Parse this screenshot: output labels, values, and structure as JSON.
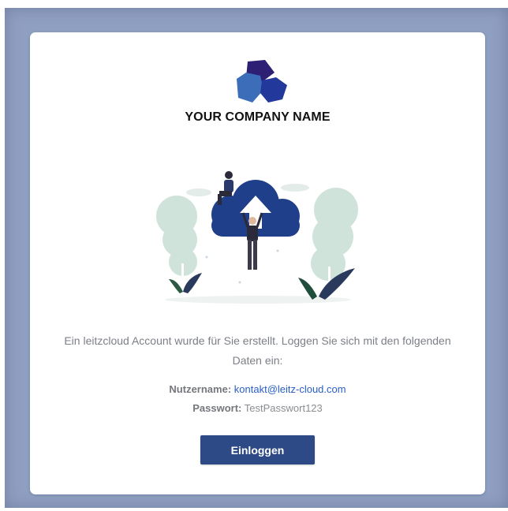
{
  "company": {
    "name": "YOUR COMPANY NAME"
  },
  "message": {
    "text": "Ein leitzcloud Account wurde für Sie erstellt. Loggen Sie sich mit den folgenden Daten ein:"
  },
  "credentials": {
    "username_label": "Nutzername:",
    "username_value": "kontakt@leitz-cloud.com",
    "password_label": "Passwort:",
    "password_value": "TestPasswort123"
  },
  "actions": {
    "login_label": "Einloggen"
  },
  "colors": {
    "backdrop": "#8f9fc1",
    "button": "#2d4a86",
    "link": "#2a5ec5",
    "cloud": "#1f3f8a",
    "foliage": "#cfe3da"
  },
  "icons": {
    "logo": "company-logo-hexagons",
    "illustration": "cloud-upload-illustration"
  }
}
